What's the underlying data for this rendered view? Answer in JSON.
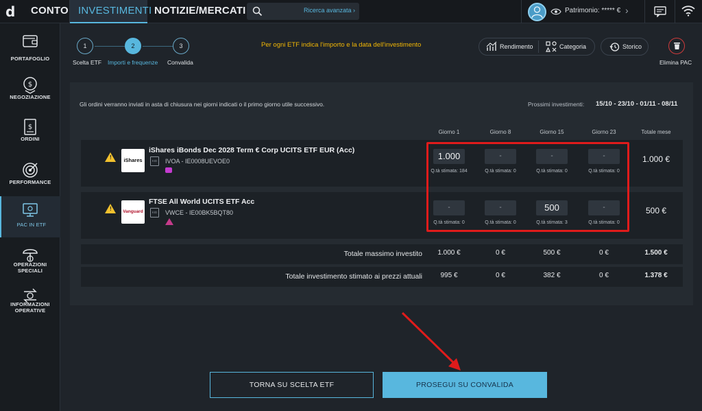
{
  "top_bar": {
    "logo": "d",
    "tabs": [
      {
        "label": "CONTO"
      },
      {
        "label": "INVESTIMENTI"
      },
      {
        "label": "NOTIZIE/MERCATI"
      }
    ],
    "search_advanced": "Ricerca avanzata",
    "patrimonio": "Patrimonio: ***** €"
  },
  "sidebar": {
    "items": [
      {
        "label": "PORTAFOGLIO",
        "icon": "wallet-icon"
      },
      {
        "label": "NEGOZIAZIONE",
        "icon": "trade-icon"
      },
      {
        "label": "ORDINI",
        "icon": "orders-icon"
      },
      {
        "label": "PERFORMANCE",
        "icon": "target-icon"
      },
      {
        "label": "PAC IN ETF",
        "icon": "monitor-icon"
      },
      {
        "label_line1": "OPERAZIONI",
        "label_line2": "SPECIALI",
        "icon": "money-umbrella-icon"
      },
      {
        "label_line1": "INFORMAZIONI",
        "label_line2": "OPERATIVE",
        "icon": "arrows-swap-icon"
      }
    ]
  },
  "stepper": {
    "steps": [
      {
        "number": "1",
        "label": "Scelta ETF"
      },
      {
        "number": "2",
        "label": "Importi e frequenze"
      },
      {
        "number": "3",
        "label": "Convalida"
      }
    ],
    "hint": "Per ogni ETF indica l'importo e la data dell'investimento"
  },
  "actions": {
    "rendimento": "Rendimento",
    "categoria": "Categoria",
    "storico": "Storico",
    "elimina": "Elimina PAC"
  },
  "panel": {
    "info": "Gli ordini verranno inviati in asta di chiusura nei giorni indicati o il primo giorno utile successivo.",
    "next_label": "Prossimi investimenti:",
    "next_dates": "15/10 - 23/10 - 01/11 - 08/11"
  },
  "columns": [
    "Giorno 1",
    "Giorno 8",
    "Giorno 15",
    "Giorno 23",
    "Totale mese"
  ],
  "etfs": [
    {
      "name": "iShares iBonds Dec 2028 Term € Corp UCITS ETF EUR (Acc)",
      "code": "IVOA - IE0008UEVOE0",
      "logo": "iShares",
      "amounts": [
        "1.000",
        "-",
        "-",
        "-"
      ],
      "qty": [
        "Q.tà stimata: 184",
        "Q.tà stimata: 0",
        "Q.tà stimata: 0",
        "Q.tà stimata: 0"
      ],
      "total": "1.000 €"
    },
    {
      "name": "FTSE All World UCITS ETF Acc",
      "code": "VWCE - IE00BK5BQT80",
      "logo": "Vanguard",
      "amounts": [
        "-",
        "-",
        "500",
        "-"
      ],
      "qty": [
        "Q.tà stimata: 0",
        "Q.tà stimata: 0",
        "Q.tà stimata: 3",
        "Q.tà stimata: 0"
      ],
      "total": "500 €"
    }
  ],
  "totals": {
    "max_label": "Totale massimo investito",
    "max_values": [
      "1.000 €",
      "0 €",
      "500 €",
      "0 €",
      "1.500 €"
    ],
    "est_label": "Totale investimento stimato ai prezzi attuali",
    "est_values": [
      "995 €",
      "0 €",
      "382 €",
      "0 €",
      "1.378 €"
    ]
  },
  "buttons": {
    "back": "TORNA SU SCELTA ETF",
    "next": "PROSEGUI SU CONVALIDA"
  },
  "colors": {
    "accent": "#58b7de",
    "warning": "#f2b705",
    "highlight": "#e01b1b"
  }
}
